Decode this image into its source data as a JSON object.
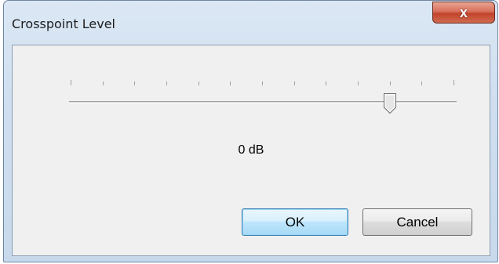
{
  "window": {
    "title": "Crosspoint Level",
    "close_glyph": "x"
  },
  "slider": {
    "min_value": -30,
    "max_value": 6,
    "step": 3,
    "current_value": 0,
    "value_label": "0 dB"
  },
  "buttons": {
    "ok_label": "OK",
    "cancel_label": "Cancel"
  },
  "colors": {
    "accent": "#3c7fb1",
    "close": "#c2442b"
  }
}
